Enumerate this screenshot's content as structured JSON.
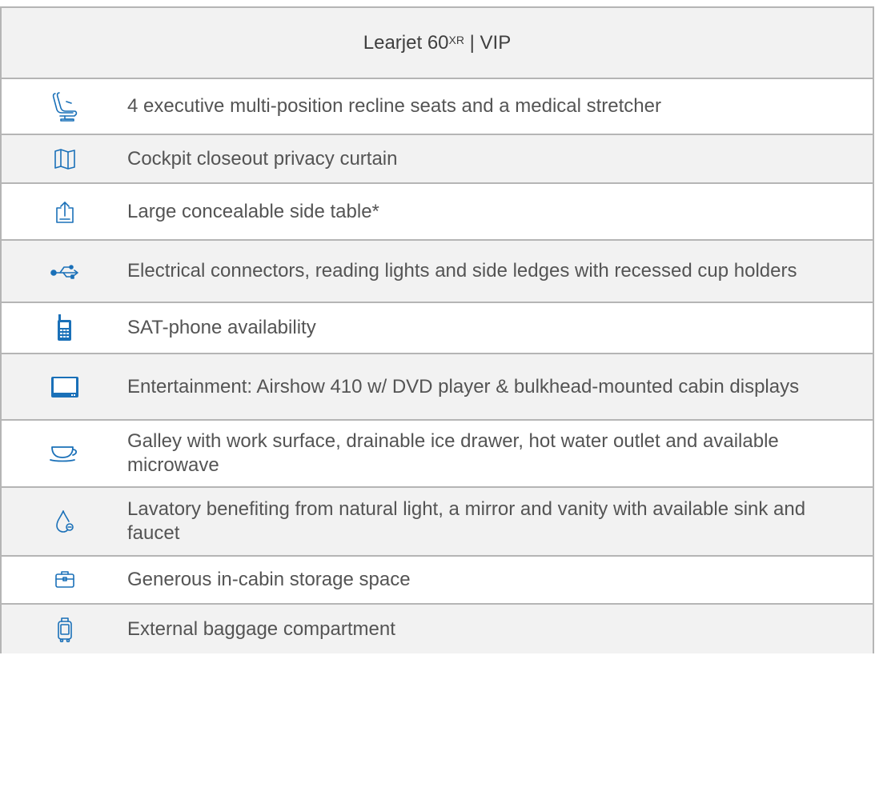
{
  "header": {
    "model": "Learjet 60",
    "model_superscript": "XR",
    "separator": "|",
    "variant": "VIP"
  },
  "accent_color": "#1a70b8",
  "features": [
    {
      "icon": "seat-icon",
      "text": "4 executive multi-position recline seats and a medical stretcher"
    },
    {
      "icon": "curtain-icon",
      "text": "Cockpit closeout privacy curtain"
    },
    {
      "icon": "side-table-icon",
      "text": "Large concealable side table*"
    },
    {
      "icon": "usb-icon",
      "text": "Electrical connectors, reading lights and side ledges with recessed cup holders"
    },
    {
      "icon": "sat-phone-icon",
      "text": "SAT-phone availability"
    },
    {
      "icon": "display-icon",
      "text": "Entertainment: Airshow 410 w/ DVD player & bulkhead-mounted cabin displays"
    },
    {
      "icon": "cup-icon",
      "text": "Galley with work surface, drainable ice drawer, hot water outlet and available microwave"
    },
    {
      "icon": "water-drop-icon",
      "text": "Lavatory benefiting from natural light, a mirror and vanity with available sink and faucet"
    },
    {
      "icon": "briefcase-icon",
      "text": "Generous in-cabin storage space"
    },
    {
      "icon": "luggage-icon",
      "text": "External baggage compartment"
    }
  ]
}
